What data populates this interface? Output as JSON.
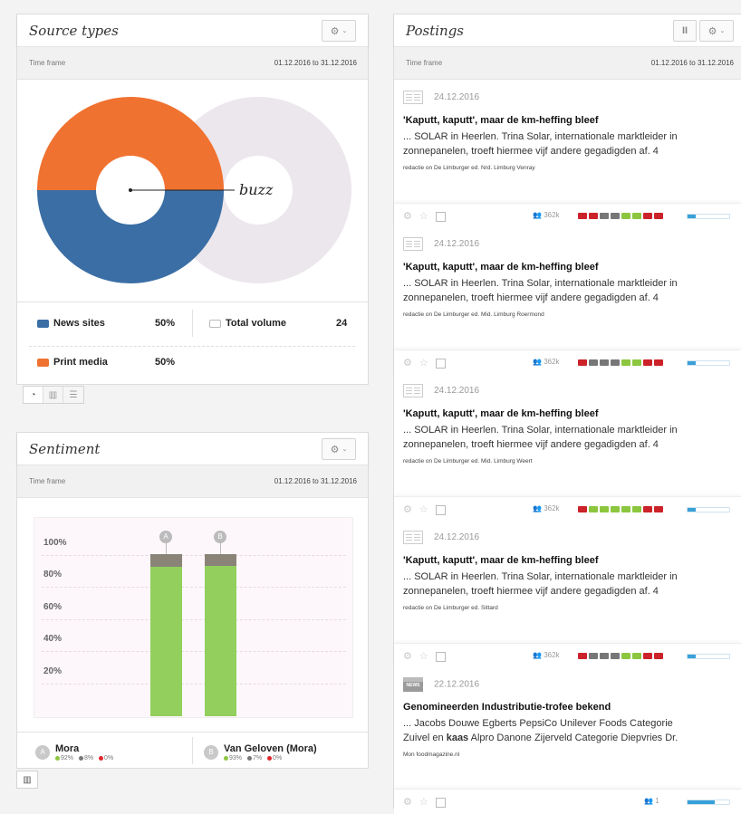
{
  "source_types": {
    "title": "Source types",
    "timeframe_label": "Time frame",
    "timeframe_range": "01.12.2016 to 31.12.2016",
    "buzz_label": "buzz",
    "legend": [
      {
        "name": "News sites",
        "pct": "50%",
        "color": "#3a6ea5"
      },
      {
        "name": "Print media",
        "pct": "50%",
        "color": "#f07230"
      }
    ],
    "total_label": "Total volume",
    "total_value": "24",
    "slices": [
      {
        "name": "News sites",
        "fraction": 0.5,
        "color": "#3a6ea5"
      },
      {
        "name": "Print media",
        "fraction": 0.5,
        "color": "#f07230"
      }
    ]
  },
  "sentiment": {
    "title": "Sentiment",
    "timeframe_label": "Time frame",
    "timeframe_range": "01.12.2016 to 31.12.2016",
    "y_ticks": [
      "100%",
      "80%",
      "60%",
      "40%",
      "20%"
    ],
    "entities": [
      {
        "marker": "A",
        "name": "Mora",
        "pos": "92%",
        "neu": "8%",
        "neg": "0%"
      },
      {
        "marker": "B",
        "name": "Van Geloven (Mora)",
        "pos": "93%",
        "neu": "7%",
        "neg": "0%"
      }
    ]
  },
  "chart_data": {
    "type": "bar",
    "categories": [
      "A",
      "B"
    ],
    "series": [
      {
        "name": "positive",
        "values": [
          92,
          93
        ],
        "color": "#92cf5c"
      },
      {
        "name": "neutral",
        "values": [
          8,
          7
        ],
        "color": "#8a8478"
      },
      {
        "name": "negative",
        "values": [
          0,
          0
        ],
        "color": "#e0262c"
      }
    ],
    "ylim": [
      0,
      100
    ],
    "stacked": true
  },
  "postings": {
    "title": "Postings",
    "timeframe_label": "Time frame",
    "timeframe_range": "01.12.2016 to 31.12.2016",
    "items": [
      {
        "date": "24.12.2016",
        "icon": "newspaper",
        "title": "'Kaputt, kaputt', maar de km-heffing bleef",
        "line1": "... SOLAR in Heerlen. Trina Solar, internationale marktleider in",
        "line2": "zonnepanelen, troeft hiermee vijf andere gegadigden af. 4",
        "source": "redactie on De Limburger ed. Nrd. Limburg Venray",
        "reach": "362k",
        "squares": [
          "#cc2229",
          "#cc2229",
          "#777",
          "#777",
          "#8cc63f",
          "#8cc63f",
          "#cc2229",
          "#cc2229"
        ],
        "meter": 0.2
      },
      {
        "date": "24.12.2016",
        "icon": "newspaper",
        "title": "'Kaputt, kaputt', maar de km-heffing bleef",
        "line1": "... SOLAR in Heerlen. Trina Solar, internationale marktleider in",
        "line2": "zonnepanelen, troeft hiermee vijf andere gegadigden af. 4",
        "source": "redactie on De Limburger ed. Mid. Limburg Roermond",
        "reach": "362k",
        "squares": [
          "#cc2229",
          "#777",
          "#777",
          "#777",
          "#8cc63f",
          "#8cc63f",
          "#cc2229",
          "#cc2229"
        ],
        "meter": 0.2
      },
      {
        "date": "24.12.2016",
        "icon": "newspaper",
        "title": "'Kaputt, kaputt', maar de km-heffing bleef",
        "line1": "... SOLAR in Heerlen. Trina Solar, internationale marktleider in",
        "line2": "zonnepanelen, troeft hiermee vijf andere gegadigden af. 4",
        "source": "redactie on De Limburger ed. Mid. Limburg Weert",
        "reach": "362k",
        "squares": [
          "#cc2229",
          "#8cc63f",
          "#8cc63f",
          "#8cc63f",
          "#8cc63f",
          "#8cc63f",
          "#cc2229",
          "#cc2229"
        ],
        "meter": 0.2
      },
      {
        "date": "24.12.2016",
        "icon": "newspaper",
        "title": "'Kaputt, kaputt', maar de km-heffing bleef",
        "line1": "... SOLAR in Heerlen. Trina Solar, internationale marktleider in",
        "line2": "zonnepanelen, troeft hiermee vijf andere gegadigden af. 4",
        "source": "redactie on De Limburger ed. Sittard",
        "reach": "362k",
        "squares": [
          "#cc2229",
          "#777",
          "#777",
          "#777",
          "#8cc63f",
          "#8cc63f",
          "#cc2229",
          "#cc2229"
        ],
        "meter": 0.2
      },
      {
        "date": "22.12.2016",
        "icon": "news",
        "icon_text": "NEWS",
        "title": "Genomineerden Industributie-trofee bekend",
        "line1": "... Jacobs Douwe Egberts PepsiCo Unilever Foods Categorie",
        "line2_pre": "Zuivel en ",
        "line2_bold": "kaas",
        "line2_post": " Alpro Danone Zijerveld Categorie Diepvries Dr.",
        "source": "Mon foodmagazine.nl",
        "reach": "1",
        "squares": [],
        "meter": 0.65
      }
    ]
  }
}
